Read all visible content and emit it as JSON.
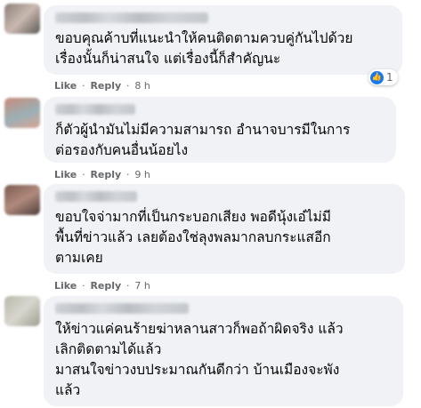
{
  "comments": [
    {
      "lines": [
        "ขอบคุณค้าบที่แนะนำให้คนติดตามควบคู่กันไปด้วย",
        "เรื่องนั้นก็น่าสนใจ แต่เรื่องนี้ก็สำคัญนะ"
      ],
      "like": "Like",
      "reply": "Reply",
      "time": "8 h",
      "reaction_count": "1",
      "avatar_colors": [
        "#8a7f7a",
        "#c9b9b0",
        "#5f5a56"
      ]
    },
    {
      "lines": [
        "ก็ตัวผู้นำมันไม่มีความสามารถ อำนาจบารมีในการ",
        "ต่อรองกับคนอื่นน้อยไง"
      ],
      "like": "Like",
      "reply": "Reply",
      "time": "9 h",
      "avatar_colors": [
        "#c98b7a",
        "#9bb0b6",
        "#d9a493"
      ]
    },
    {
      "lines": [
        "ขอบใจจ่ามากที่เป็นกระบอกเสียง พอดีนุ้งเอ๋ไม่มี",
        "พื้นที่ข่าวแล้ว เลยต้องใช่ลุงพลมากลบกระแสอีก",
        "ตามเคย"
      ],
      "like": "Like",
      "reply": "Reply",
      "time": "7 h",
      "avatar_colors": [
        "#7a5a50",
        "#b08a7c",
        "#4f3f3a"
      ]
    },
    {
      "lines": [
        "ให้ข่าวแค่คนร้ายฆ่าหลานสาวก็พอถ้าผิดจริง แล้ว",
        "เลิกติดตามได้แล้ว",
        "มาสนใจข่าวงบประมาณกันดีกว่า บ้านเมืองจะพัง",
        "แล้ว"
      ],
      "avatar_colors": [
        "#b7b9a8",
        "#d8d6cf",
        "#9ea08f"
      ]
    }
  ],
  "sep": "·"
}
